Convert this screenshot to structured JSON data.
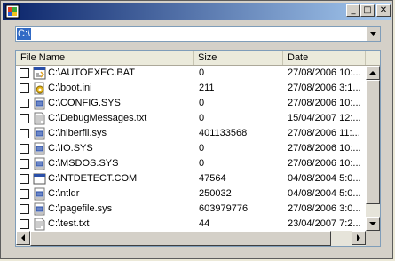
{
  "window": {
    "title": "",
    "minimize_glyph": "_",
    "maximize_glyph": "□",
    "close_glyph": "✕"
  },
  "path_combo": {
    "value": "C:\\"
  },
  "columns": [
    "File Name",
    "Size",
    "Date"
  ],
  "files": [
    {
      "name": "C:\\AUTOEXEC.BAT",
      "size": "0",
      "date": "27/08/2006 10:...",
      "icon": "batch-file-icon",
      "checked": false
    },
    {
      "name": "C:\\boot.ini",
      "size": "211",
      "date": "27/08/2006 3:1...",
      "icon": "ini-settings-icon",
      "checked": false
    },
    {
      "name": "C:\\CONFIG.SYS",
      "size": "0",
      "date": "27/08/2006 10:...",
      "icon": "system-file-icon",
      "checked": false
    },
    {
      "name": "C:\\DebugMessages.txt",
      "size": "0",
      "date": "15/04/2007 12:...",
      "icon": "text-file-icon",
      "checked": false
    },
    {
      "name": "C:\\hiberfil.sys",
      "size": "401133568",
      "date": "27/08/2006 11:...",
      "icon": "system-file-icon",
      "checked": false
    },
    {
      "name": "C:\\IO.SYS",
      "size": "0",
      "date": "27/08/2006 10:...",
      "icon": "system-file-icon",
      "checked": false
    },
    {
      "name": "C:\\MSDOS.SYS",
      "size": "0",
      "date": "27/08/2006 10:...",
      "icon": "system-file-icon",
      "checked": false
    },
    {
      "name": "C:\\NTDETECT.COM",
      "size": "47564",
      "date": "04/08/2004 5:0...",
      "icon": "executable-icon",
      "checked": false
    },
    {
      "name": "C:\\ntldr",
      "size": "250032",
      "date": "04/08/2004 5:0...",
      "icon": "system-file-icon",
      "checked": false
    },
    {
      "name": "C:\\pagefile.sys",
      "size": "603979776",
      "date": "27/08/2006 3:0...",
      "icon": "system-file-icon",
      "checked": false
    },
    {
      "name": "C:\\test.txt",
      "size": "44",
      "date": "23/04/2007 7:2...",
      "icon": "text-file-icon",
      "checked": false
    }
  ],
  "colors": {
    "titlebar_start": "#0a246a",
    "titlebar_end": "#a6caf0",
    "selection": "#316ac5",
    "face": "#d4d0c8"
  }
}
